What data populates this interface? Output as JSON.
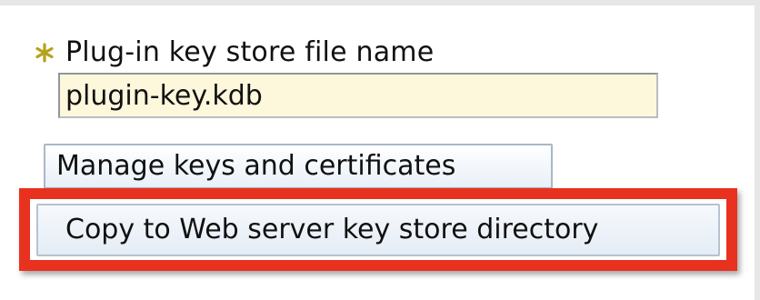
{
  "form": {
    "key_store_label": "Plug-in key store file name",
    "key_store_value": "plugin-key.kdb"
  },
  "buttons": {
    "manage_label": "Manage keys and certificates",
    "copy_label": "Copy to Web server key store directory"
  },
  "colors": {
    "required_star": "#b5a21a",
    "input_background": "#fdf7dc",
    "highlight_border": "#e8321f"
  },
  "icons": {
    "required": "asterisk-icon"
  }
}
